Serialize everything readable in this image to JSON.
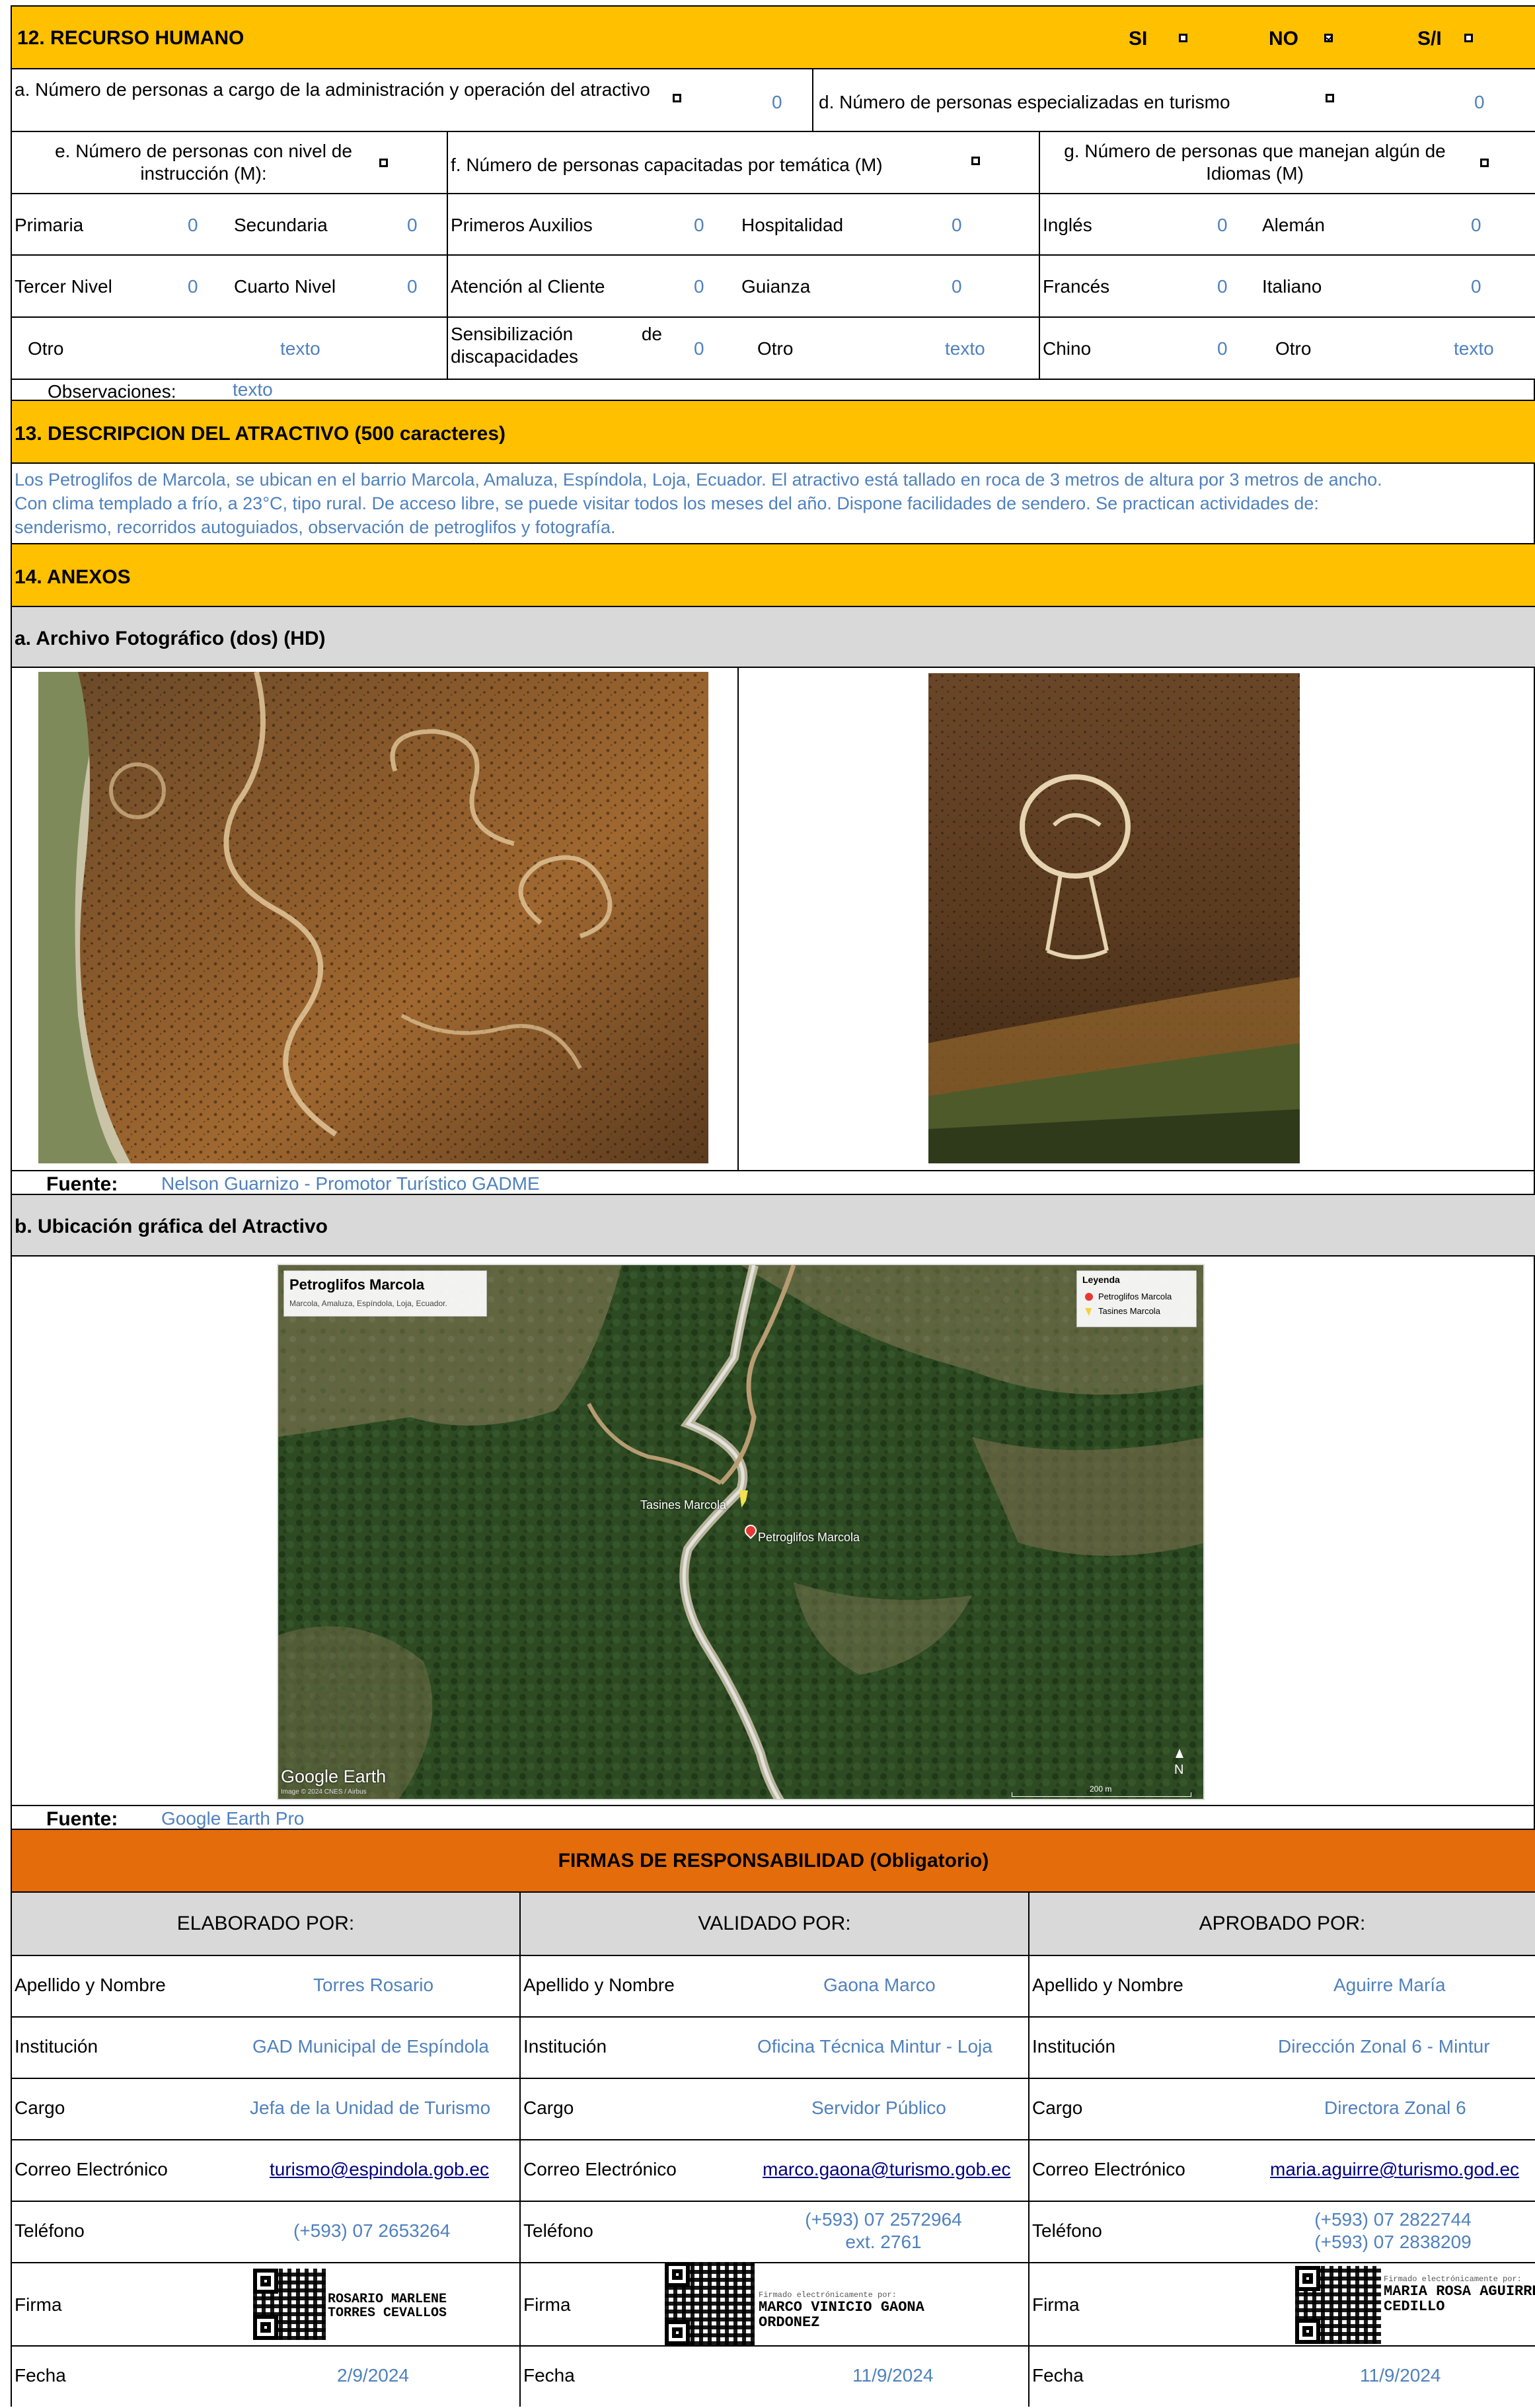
{
  "recurso_humano": {
    "title": "12. RECURSO HUMANO",
    "options": [
      {
        "label": "SI",
        "checked": false
      },
      {
        "label": "NO",
        "checked": true
      },
      {
        "label": "S/I",
        "checked": false
      }
    ],
    "a_label": "a. Número de personas a cargo de la administración y operación del atractivo",
    "a_value": "0",
    "d_label": "d. Número de personas especializadas en turismo",
    "d_value": "0",
    "e_label": "e. Número de personas con nivel de instrucción (M):",
    "f_label": "f. Número de personas capacitadas por temática (M)",
    "g_label": "g. Número de personas que manejan algún de Idiomas (M)",
    "rows": [
      [
        [
          "Primaria",
          "0"
        ],
        [
          "Secundaria",
          "0"
        ],
        [
          "Primeros Auxilios",
          "0"
        ],
        [
          "Hospitalidad",
          "0"
        ],
        [
          "Inglés",
          "0"
        ],
        [
          "Alemán",
          "0"
        ]
      ],
      [
        [
          "Tercer Nivel",
          "0"
        ],
        [
          "Cuarto Nivel",
          "0"
        ],
        [
          "Atención al Cliente",
          "0"
        ],
        [
          "Guianza",
          "0"
        ],
        [
          "Francés",
          "0"
        ],
        [
          "Italiano",
          "0"
        ]
      ],
      [
        [
          "Otro",
          "texto"
        ],
        [
          "",
          ""
        ],
        [
          "Sensibilización de discapacidades",
          "0"
        ],
        [
          "Otro",
          "texto"
        ],
        [
          "Chino",
          "0"
        ],
        [
          "Otro",
          "texto"
        ]
      ]
    ],
    "obs_label": "Observaciones:",
    "obs_value": "texto"
  },
  "descripcion": {
    "title": "13. DESCRIPCION DEL ATRACTIVO (500 caracteres)",
    "lines": [
      "Los Petroglifos de Marcola, se ubican en el barrio Marcola, Amaluza, Espíndola, Loja, Ecuador. El atractivo está tallado en roca de 3 metros de altura por 3 metros de ancho.",
      "Con clima templado a frío, a 23°C, tipo rural. De acceso libre, se puede visitar todos los meses del año. Dispone facilidades de sendero. Se practican actividades de:",
      "senderismo, recorridos autoguiados, observación de petroglifos y fotografía."
    ]
  },
  "anexos": {
    "title": "14. ANEXOS",
    "photo_title": "a. Archivo Fotográfico (dos) (HD)",
    "fuente_label": "Fuente:",
    "photo_source": "Nelson Guarnizo - Promotor Turístico GADME",
    "map_title": "b. Ubicación gráfica del Atractivo",
    "map_source": "Google Earth Pro",
    "map": {
      "title": "Petroglifos Marcola",
      "subtitle": "Marcola, Amaluza, Espíndola, Loja, Ecuador.",
      "legend_title": "Leyenda",
      "legend_items": [
        "Petroglifos Marcola",
        "Tasines Marcola"
      ],
      "marker1": "Tasines Marcola",
      "marker2": "Petroglifos Marcola",
      "brand": "Google Earth",
      "credit": "Image © 2024 CNES / Airbus",
      "scale": "200 m",
      "north": "N"
    }
  },
  "firmas": {
    "title": "FIRMAS DE RESPONSABILIDAD (Obligatorio)",
    "columns": [
      {
        "header": "ELABORADO POR:",
        "nombre": "Torres Rosario",
        "institucion": "GAD Municipal de Espíndola",
        "cargo": "Jefa de la Unidad de Turismo",
        "correo": "turismo@espindola.gob.ec",
        "telefono": [
          "(+593) 07 2653264"
        ],
        "firma": [
          "ROSARIO MARLENE",
          "TORRES CEVALLOS"
        ],
        "firma_note": "",
        "fecha": "2/9/2024"
      },
      {
        "header": "VALIDADO  POR:",
        "nombre": "Gaona Marco",
        "institucion": "Oficina Técnica Mintur - Loja",
        "cargo": "Servidor Público",
        "correo": "marco.gaona@turismo.gob.ec",
        "telefono": [
          "(+593) 07 2572964",
          "ext. 2761"
        ],
        "firma": [
          "MARCO VINICIO GAONA",
          "ORDONEZ"
        ],
        "firma_note": "Firmado electrónicamente por:",
        "fecha": "11/9/2024"
      },
      {
        "header": "APROBADO POR:",
        "nombre": "Aguirre María",
        "institucion": "Dirección Zonal 6 - Mintur",
        "cargo": "Directora Zonal 6",
        "correo": "maria.aguirre@turismo.god.ec",
        "telefono": [
          "(+593) 07 2822744",
          "(+593) 07 2838209"
        ],
        "firma": [
          "MARIA ROSA AGUIRRE",
          "CEDILLO"
        ],
        "firma_note": "Firmado electrónicamente por:",
        "fecha": "11/9/2024"
      }
    ],
    "labels": {
      "nombre": "Apellido y Nombre",
      "institucion": "Institución",
      "cargo": "Cargo",
      "correo": "Correo Electrónico",
      "telefono": "Teléfono",
      "firma": "Firma",
      "fecha": "Fecha"
    }
  }
}
